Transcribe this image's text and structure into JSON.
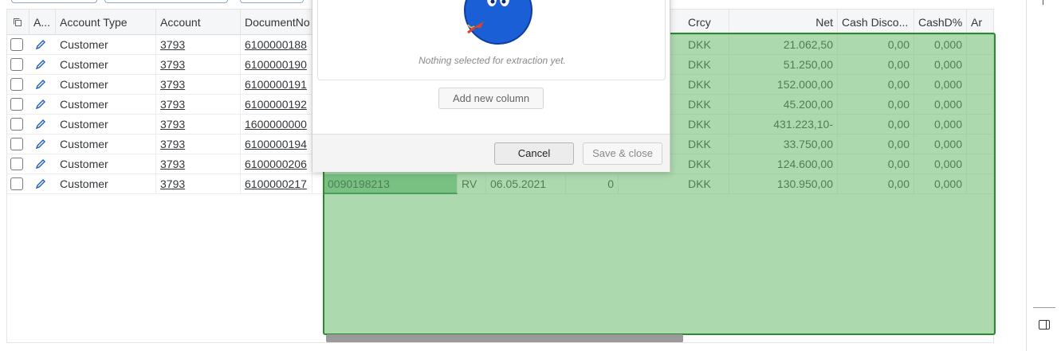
{
  "table": {
    "columns": {
      "select": "",
      "a": "A...",
      "account_type": "Account Type",
      "account": "Account",
      "document_no": "DocumentNo",
      "crcy": "Crcy",
      "net": "Net",
      "cash_disco": "Cash Disco...",
      "cashd_pct": "CashD%",
      "ar": "Ar"
    },
    "rows": [
      {
        "account_type": "Customer",
        "account": "3793",
        "document_no": "6100000188",
        "crcy": "DKK",
        "net": "21.062,50",
        "cash_disco": "0,00",
        "cashd_pct": "0,000"
      },
      {
        "account_type": "Customer",
        "account": "3793",
        "document_no": "6100000190",
        "crcy": "DKK",
        "net": "51.250,00",
        "cash_disco": "0,00",
        "cashd_pct": "0,000"
      },
      {
        "account_type": "Customer",
        "account": "3793",
        "document_no": "6100000191",
        "crcy": "DKK",
        "net": "152.000,00",
        "cash_disco": "0,00",
        "cashd_pct": "0,000"
      },
      {
        "account_type": "Customer",
        "account": "3793",
        "document_no": "6100000192",
        "crcy": "DKK",
        "net": "45.200,00",
        "cash_disco": "0,00",
        "cashd_pct": "0,000"
      },
      {
        "account_type": "Customer",
        "account": "3793",
        "document_no": "1600000000",
        "crcy": "DKK",
        "net": "431.223,10-",
        "cash_disco": "0,00",
        "cashd_pct": "0,000"
      },
      {
        "account_type": "Customer",
        "account": "3793",
        "document_no": "6100000194",
        "crcy": "DKK",
        "net": "33.750,00",
        "cash_disco": "0,00",
        "cashd_pct": "0,000"
      },
      {
        "account_type": "Customer",
        "account": "3793",
        "document_no": "6100000206",
        "crcy": "DKK",
        "net": "124.600,00",
        "cash_disco": "0,00",
        "cashd_pct": "0,000"
      },
      {
        "account_type": "Customer",
        "account": "3793",
        "document_no": "6100000217",
        "reference": "0090198213",
        "doc_type": "RV",
        "date": "06.05.2021",
        "num": "0",
        "crcy": "DKK",
        "net": "130.950,00",
        "cash_disco": "0,00",
        "cashd_pct": "0,000"
      }
    ]
  },
  "dialog": {
    "empty_text": "Nothing selected for extraction yet.",
    "add_column_label": "Add new column",
    "cancel_label": "Cancel",
    "save_close_label": "Save & close"
  },
  "colors": {
    "overlay": "#68ba6c",
    "overlay_border": "#2b8a2b",
    "mascot": "#1a5fd6"
  },
  "icons": {
    "select_all": "copy-icon",
    "edit": "pencil-icon",
    "side_panel": "side-panel-icon"
  }
}
